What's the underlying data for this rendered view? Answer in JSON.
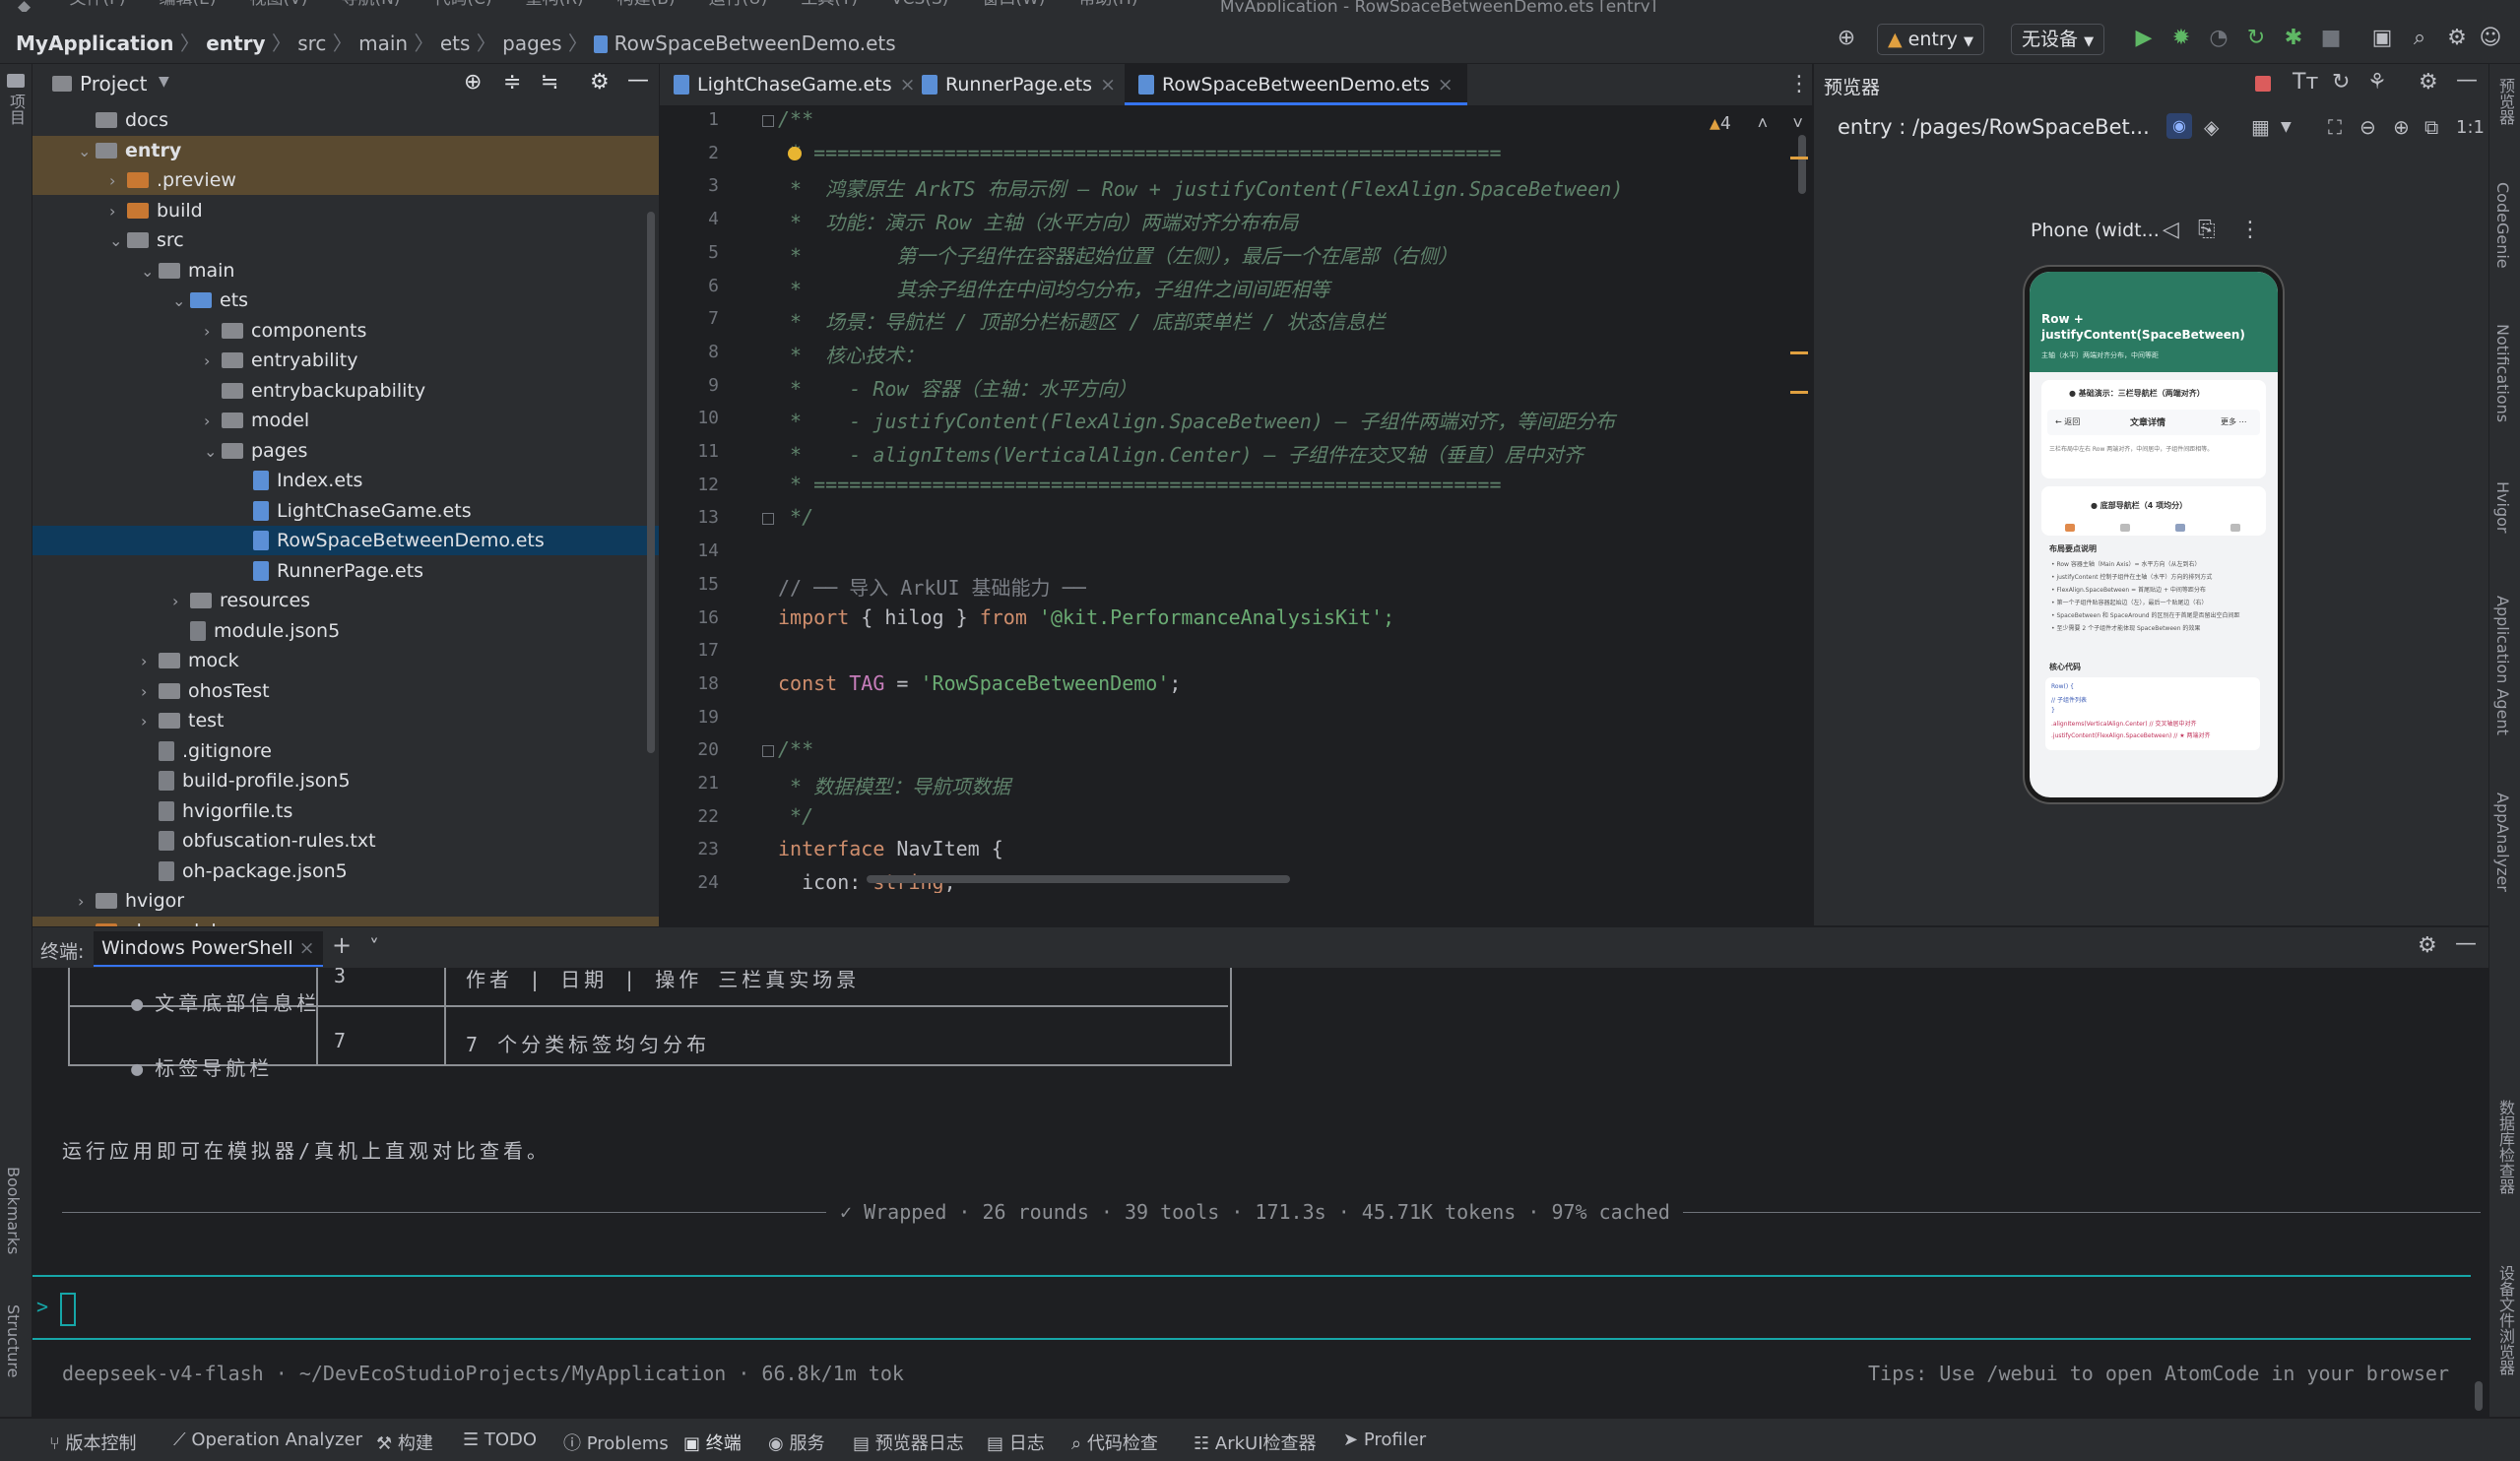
{
  "menu": [
    "文件(F)",
    "编辑(E)",
    "视图(V)",
    "导航(N)",
    "代码(C)",
    "重构(R)",
    "构建(B)",
    "运行(U)",
    "工具(T)",
    "VCS(S)",
    "窗口(W)",
    "帮助(H)"
  ],
  "window_title": "MyApplication - RowSpaceBetweenDemo.ets [entry]",
  "breadcrumb": [
    "MyApplication",
    "entry",
    "src",
    "main",
    "ets",
    "pages",
    "RowSpaceBetweenDemo.ets"
  ],
  "toolbar": {
    "module_select": "entry",
    "device_select": "无设备"
  },
  "project": {
    "title": "Project",
    "tree": [
      {
        "label": "docs",
        "depth": 1,
        "type": "folder",
        "chev": ""
      },
      {
        "label": "entry",
        "depth": 1,
        "type": "folder",
        "chev": "v",
        "bold": true
      },
      {
        "label": ".preview",
        "depth": 2,
        "type": "folder-orange",
        "chev": ">"
      },
      {
        "label": "build",
        "depth": 2,
        "type": "folder-orange",
        "chev": ">"
      },
      {
        "label": "src",
        "depth": 2,
        "type": "folder",
        "chev": "v"
      },
      {
        "label": "main",
        "depth": 3,
        "type": "folder",
        "chev": "v"
      },
      {
        "label": "ets",
        "depth": 4,
        "type": "folder-blue",
        "chev": "v"
      },
      {
        "label": "components",
        "depth": 5,
        "type": "folder",
        "chev": ">"
      },
      {
        "label": "entryability",
        "depth": 5,
        "type": "folder",
        "chev": ">"
      },
      {
        "label": "entrybackupability",
        "depth": 5,
        "type": "folder",
        "chev": ""
      },
      {
        "label": "model",
        "depth": 5,
        "type": "folder",
        "chev": ">"
      },
      {
        "label": "pages",
        "depth": 5,
        "type": "folder",
        "chev": "v"
      },
      {
        "label": "Index.ets",
        "depth": 6,
        "type": "file",
        "chev": ""
      },
      {
        "label": "LightChaseGame.ets",
        "depth": 6,
        "type": "file",
        "chev": ""
      },
      {
        "label": "RowSpaceBetweenDemo.ets",
        "depth": 6,
        "type": "file",
        "chev": "",
        "selected": true
      },
      {
        "label": "RunnerPage.ets",
        "depth": 6,
        "type": "file",
        "chev": ""
      },
      {
        "label": "resources",
        "depth": 4,
        "type": "folder",
        "chev": ">"
      },
      {
        "label": "module.json5",
        "depth": 4,
        "type": "file-gray",
        "chev": ""
      },
      {
        "label": "mock",
        "depth": 3,
        "type": "folder",
        "chev": ">"
      },
      {
        "label": "ohosTest",
        "depth": 3,
        "type": "folder",
        "chev": ">"
      },
      {
        "label": "test",
        "depth": 3,
        "type": "folder",
        "chev": ">"
      },
      {
        "label": ".gitignore",
        "depth": 3,
        "type": "file-gray",
        "chev": ""
      },
      {
        "label": "build-profile.json5",
        "depth": 3,
        "type": "file-gray",
        "chev": ""
      },
      {
        "label": "hvigorfile.ts",
        "depth": 3,
        "type": "file-gray",
        "chev": ""
      },
      {
        "label": "obfuscation-rules.txt",
        "depth": 3,
        "type": "file-gray",
        "chev": ""
      },
      {
        "label": "oh-package.json5",
        "depth": 3,
        "type": "file-gray",
        "chev": ""
      },
      {
        "label": "hvigor",
        "depth": 1,
        "type": "folder",
        "chev": ">"
      },
      {
        "label": "oh_modules",
        "depth": 1,
        "type": "folder-orange",
        "chev": "v"
      }
    ]
  },
  "editor_tabs": [
    {
      "label": "LightChaseGame.ets",
      "active": false
    },
    {
      "label": "RunnerPage.ets",
      "active": false
    },
    {
      "label": "RowSpaceBetweenDemo.ets",
      "active": true
    }
  ],
  "editor": {
    "warnings": "4",
    "lines": [
      {
        "n": "1",
        "text": "/**",
        "cls": "c-doc"
      },
      {
        "n": "2",
        "text": " * ==========================================================",
        "cls": "c-doc"
      },
      {
        "n": "3",
        "text": " *  鸿蒙原生 ArkTS 布局示例 — Row + justifyContent(FlexAlign.SpaceBetween)",
        "cls": "c-doc"
      },
      {
        "n": "4",
        "text": " *  功能：演示 Row 主轴（水平方向）两端对齐分布布局",
        "cls": "c-doc"
      },
      {
        "n": "5",
        "text": " *        第一个子组件在容器起始位置（左侧），最后一个在尾部（右侧）",
        "cls": "c-doc"
      },
      {
        "n": "6",
        "text": " *        其余子组件在中间均匀分布，子组件之间间距相等",
        "cls": "c-doc"
      },
      {
        "n": "7",
        "text": " *  场景：导航栏 / 顶部分栏标题区 / 底部菜单栏 / 状态信息栏",
        "cls": "c-doc"
      },
      {
        "n": "8",
        "text": " *  核心技术：",
        "cls": "c-doc"
      },
      {
        "n": "9",
        "text": " *    - Row 容器（主轴：水平方向）",
        "cls": "c-doc"
      },
      {
        "n": "10",
        "text": " *    - justifyContent(FlexAlign.SpaceBetween) — 子组件两端对齐，等间距分布",
        "cls": "c-doc"
      },
      {
        "n": "11",
        "text": " *    - alignItems(VerticalAlign.Center) — 子组件在交叉轴（垂直）居中对齐",
        "cls": "c-doc"
      },
      {
        "n": "12",
        "text": " * ==========================================================",
        "cls": "c-doc"
      },
      {
        "n": "13",
        "text": " */",
        "cls": "c-doc"
      },
      {
        "n": "14",
        "text": "",
        "cls": ""
      },
      {
        "n": "15",
        "text": "// ── 导入 ArkUI 基础能力 ──",
        "cls": "c-com"
      },
      {
        "n": "16",
        "text": "",
        "cls": "",
        "parts": [
          {
            "t": "import",
            "c": "c-kw"
          },
          {
            "t": " { hilog } ",
            "c": ""
          },
          {
            "t": "from",
            "c": "c-kw"
          },
          {
            "t": " '@kit.PerformanceAnalysisKit';",
            "c": "c-str"
          }
        ]
      },
      {
        "n": "17",
        "text": "",
        "cls": ""
      },
      {
        "n": "18",
        "text": "",
        "cls": "",
        "parts": [
          {
            "t": "const",
            "c": "c-kw"
          },
          {
            "t": " TAG",
            "c": "c-const"
          },
          {
            "t": " = ",
            "c": ""
          },
          {
            "t": "'RowSpaceBetweenDemo'",
            "c": "c-str"
          },
          {
            "t": ";",
            "c": ""
          }
        ]
      },
      {
        "n": "19",
        "text": "",
        "cls": ""
      },
      {
        "n": "20",
        "text": "/**",
        "cls": "c-doc"
      },
      {
        "n": "21",
        "text": " * 数据模型：导航项数据",
        "cls": "c-doc"
      },
      {
        "n": "22",
        "text": " */",
        "cls": "c-doc"
      },
      {
        "n": "23",
        "text": "",
        "cls": "",
        "parts": [
          {
            "t": "interface",
            "c": "c-kw"
          },
          {
            "t": " NavItem {",
            "c": ""
          }
        ]
      },
      {
        "n": "24",
        "text": "",
        "cls": "",
        "parts": [
          {
            "t": "  icon",
            "c": ""
          },
          {
            "t": ": ",
            "c": ""
          },
          {
            "t": "string",
            "c": "c-kw"
          },
          {
            "t": ";",
            "c": ""
          }
        ]
      }
    ]
  },
  "preview": {
    "title": "预览器",
    "route": "entry : /pages/RowSpaceBet...",
    "device": "Phone (widt...",
    "phone": {
      "header_title": "Row + justifyContent(SpaceBetween)",
      "header_sub": "主轴（水平）两端对齐分布，中间等距",
      "demo1_title": "● 基础演示：三栏导航栏（两端对齐）",
      "demo1_left": "← 返回",
      "demo1_center": "文章详情",
      "demo1_right": "更多 ⋯",
      "demo1_note": "三栏布局中左右 Row 两端对齐，中间居中，子组件间距相等。",
      "demo2_title": "● 底部导航栏（4 项均分）",
      "points_title": "布局要点说明",
      "points": [
        "Row 容器主轴（Main Axis）= 水平方向（从左到右）",
        "justifyContent 控制子组件在主轴（水平）方向的排列方式",
        "FlexAlign.SpaceBetween = 首尾贴边 + 中间等距分布",
        "第一个子组件贴容器起始边（左），最后一个贴尾边（右）",
        "SpaceBetween 和 SpaceAround 的区别在于首尾是否留出空白间距",
        "至少需要 2 个子组件才能体现 SpaceBetween 的效果"
      ],
      "code_title": "核心代码",
      "code_lines": [
        "Row() {",
        "  // 子组件列表",
        "}",
        ".alignItems(VerticalAlign.Center)   // 交叉轴居中对齐",
        ".justifyContent(FlexAlign.SpaceBetween)  // ★ 两端对齐"
      ]
    }
  },
  "terminal": {
    "label": "终端:",
    "tab": "Windows PowerShell",
    "table_rows": [
      {
        "name": "文章底部信息栏",
        "count": "3",
        "desc": "作者 | 日期 | 操作 三栏真实场景"
      },
      {
        "name": "标签导航栏",
        "count": "7",
        "desc": "7 个分类标签均匀分布"
      }
    ],
    "run_hint": "运行应用即可在模拟器/真机上直观对比查看。",
    "summary": "✓ Wrapped · 26 rounds · 39 tools · 171.3s · 45.71K tokens · 97% cached",
    "prompt": ">",
    "footer_left": "deepseek-v4-flash · ~/DevEcoStudioProjects/MyApplication · 66.8k/1m tok",
    "footer_right": "Tips: Use /webui to open AtomCode in your browser"
  },
  "left_strip": [
    "项目",
    "Bookmarks",
    "Structure"
  ],
  "right_strip": [
    "预览器",
    "CodeGenie",
    "Notifications",
    "Hvigor",
    "Application Agent",
    "AppAnalyzer",
    "数据库检查器",
    "设备文件浏览器"
  ],
  "statusbar": [
    "版本控制",
    "Operation Analyzer",
    "构建",
    "TODO",
    "Problems",
    "终端",
    "服务",
    "预览器日志",
    "日志",
    "代码检查",
    "ArkUI检查器",
    "Profiler"
  ],
  "colors": {
    "accent": "#3574f0",
    "teal": "#16a6a8",
    "phone_header": "#2b7a62"
  }
}
